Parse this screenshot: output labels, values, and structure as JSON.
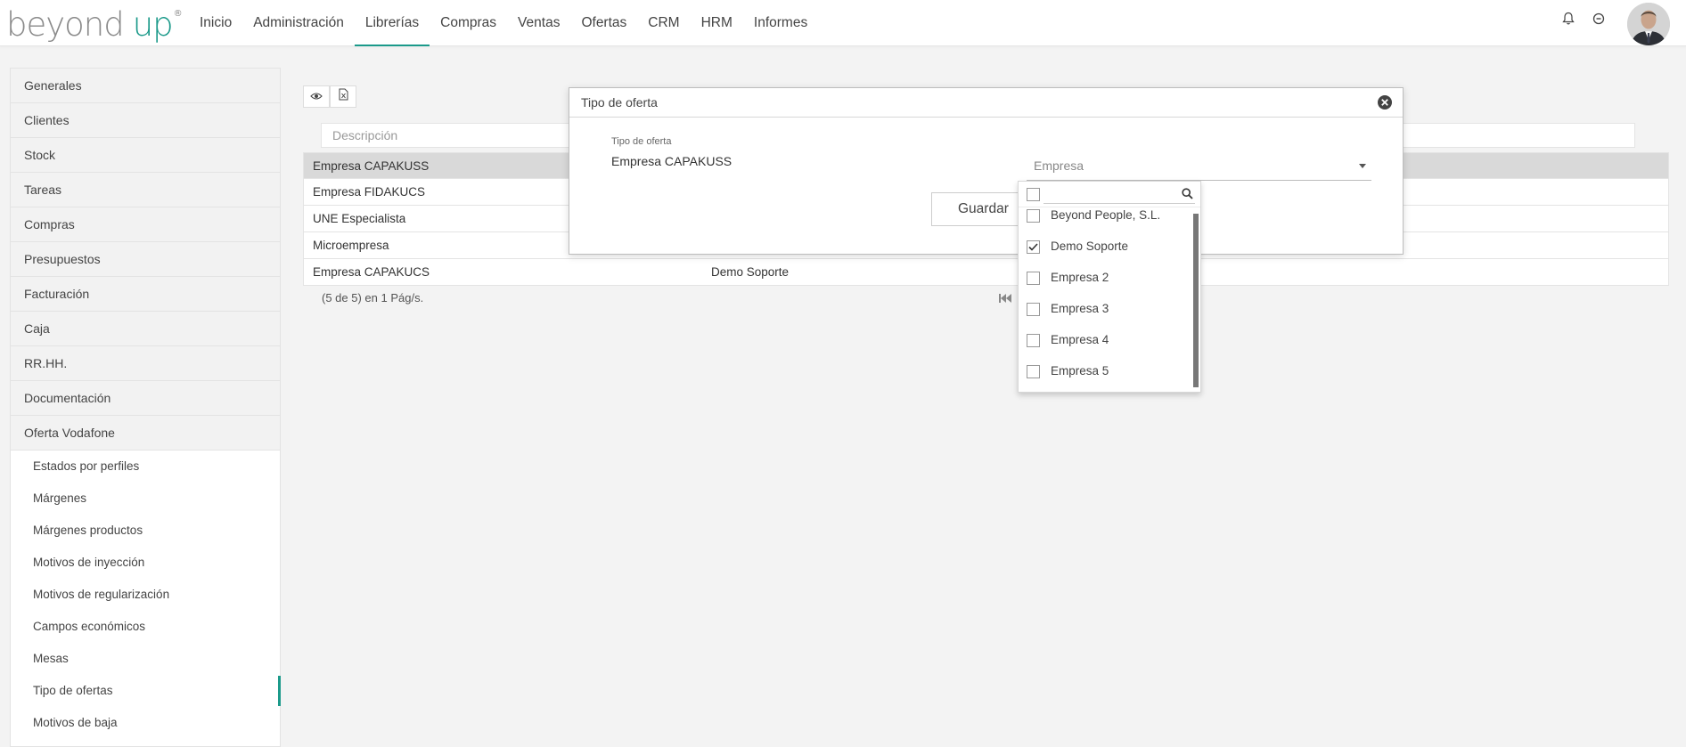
{
  "brand": {
    "word1": "beyond",
    "word2": "up",
    "mark": "®"
  },
  "nav": {
    "items": [
      "Inicio",
      "Administración",
      "Librerías",
      "Compras",
      "Ventas",
      "Ofertas",
      "CRM",
      "HRM",
      "Informes"
    ],
    "active": "Librerías"
  },
  "header_icons": [
    "bell-icon",
    "logout-icon",
    "user-avatar"
  ],
  "sidebar": {
    "sections": [
      "Generales",
      "Clientes",
      "Stock",
      "Tareas",
      "Compras",
      "Presupuestos",
      "Facturación",
      "Caja",
      "RR.HH.",
      "Documentación",
      "Oferta Vodafone"
    ],
    "subitems": [
      "Estados por perfiles",
      "Márgenes",
      "Márgenes productos",
      "Motivos de inyección",
      "Motivos de regularización",
      "Campos económicos",
      "Mesas",
      "Tipo de ofertas",
      "Motivos de baja"
    ],
    "active_subitem": "Tipo de ofertas"
  },
  "toolbar": {
    "icons": [
      "eye-icon",
      "excel-export-icon"
    ]
  },
  "filter": {
    "placeholder": "Descripción"
  },
  "table": {
    "rows": [
      {
        "descripcion": "Empresa CAPAKUSS",
        "empresa": "",
        "selected": true
      },
      {
        "descripcion": "Empresa FIDAKUCS",
        "empresa": ""
      },
      {
        "descripcion": "UNE Especialista",
        "empresa": ""
      },
      {
        "descripcion": "Microempresa",
        "empresa": ""
      },
      {
        "descripcion": "Empresa CAPAKUCS",
        "empresa": "Demo Soporte"
      }
    ],
    "pager_info": "(5 de 5) en 1 Pág/s."
  },
  "modal": {
    "title": "Tipo de oferta",
    "field_label": "Tipo de oferta",
    "field_value": "Empresa CAPAKUSS",
    "select_placeholder": "Empresa",
    "save_label": "Guardar"
  },
  "dropdown": {
    "items": [
      {
        "label": "Beyond People, S.L.",
        "checked": false
      },
      {
        "label": "Demo Soporte",
        "checked": true
      },
      {
        "label": "Empresa 2",
        "checked": false
      },
      {
        "label": "Empresa 3",
        "checked": false
      },
      {
        "label": "Empresa 4",
        "checked": false
      },
      {
        "label": "Empresa 5",
        "checked": false
      }
    ]
  },
  "colors": {
    "accent": "#1b9a8a",
    "selected_row": "#d9d9d9"
  }
}
